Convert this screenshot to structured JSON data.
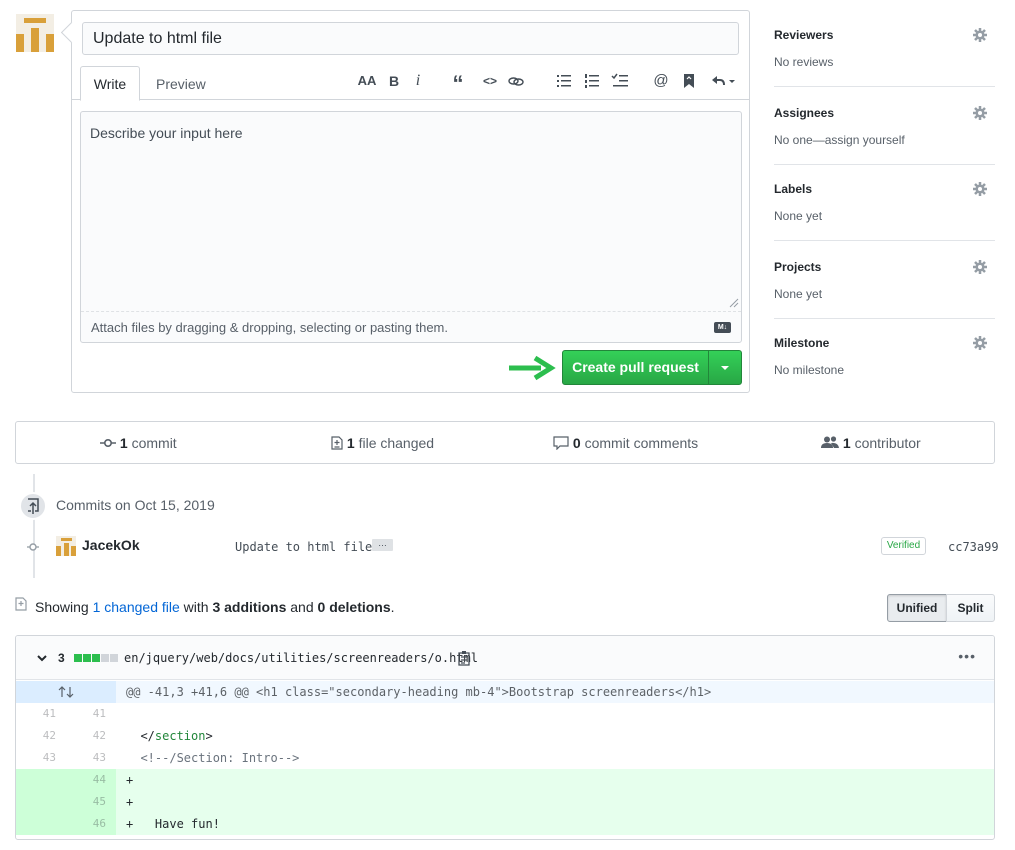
{
  "pr_form": {
    "title_value": "Update to html file",
    "tabs": {
      "write": "Write",
      "preview": "Preview"
    },
    "toolbar": {
      "heading": "AA",
      "bold": "B",
      "italic": "i",
      "quote": "“",
      "code": "<>",
      "link": "⊝",
      "ul": "☰",
      "ol": "☷",
      "task": "✓☰",
      "mention": "@",
      "saved": "■",
      "reply": "↰"
    },
    "body_placeholder": "Describe your input here",
    "attach_hint": "Attach files by dragging & dropping, selecting or pasting them.",
    "markdown_badge": "M↓",
    "create_button": "Create pull request"
  },
  "sidebar": [
    {
      "title": "Reviewers",
      "value": "No reviews"
    },
    {
      "title": "Assignees",
      "value": "No one—assign yourself"
    },
    {
      "title": "Labels",
      "value": "None yet"
    },
    {
      "title": "Projects",
      "value": "None yet"
    },
    {
      "title": "Milestone",
      "value": "No milestone"
    }
  ],
  "summary": {
    "commits_count": "1",
    "commits_label": "commit",
    "files_count": "1",
    "files_label": "file changed",
    "comments_count": "0",
    "comments_label": "commit comments",
    "contributors_count": "1",
    "contributors_label": "contributor"
  },
  "commits": {
    "date_heading": "Commits on Oct 15, 2019",
    "author": "JacekOk",
    "message": "Update to html file",
    "ellipsis": "…",
    "verified": "Verified",
    "sha": "cc73a99"
  },
  "showing": {
    "prefix": "Showing",
    "changed_files": "1 changed file",
    "with": "with",
    "additions": "3 additions",
    "and": "and",
    "deletions": "0 deletions",
    "suffix": "."
  },
  "view_toggle": {
    "unified": "Unified",
    "split": "Split",
    "selected": "unified"
  },
  "diff": {
    "changes": "3",
    "path": "en/jquery/web/docs/utilities/screenreaders/o.html",
    "more": "•••",
    "hunk": "@@ -41,3 +41,6 @@ <h1 class=\"secondary-heading mb-4\">Bootstrap screenreaders</h1>",
    "colors": {
      "addition": "#e6ffed",
      "hunk": "#f1f8ff",
      "stat_add": "#2cbe4e",
      "stat_neutral": "#d1d5da"
    },
    "lines": [
      {
        "old": "41",
        "new": "41",
        "type": "ctx",
        "text": ""
      },
      {
        "old": "42",
        "new": "42",
        "type": "ctx",
        "text": "  </section>"
      },
      {
        "old": "43",
        "new": "43",
        "type": "ctx",
        "text": "  <!--/Section: Intro-->"
      },
      {
        "old": "",
        "new": "44",
        "type": "add",
        "text": "+"
      },
      {
        "old": "",
        "new": "45",
        "type": "add",
        "text": "+"
      },
      {
        "old": "",
        "new": "46",
        "type": "add",
        "text": "+   Have fun!"
      }
    ]
  }
}
